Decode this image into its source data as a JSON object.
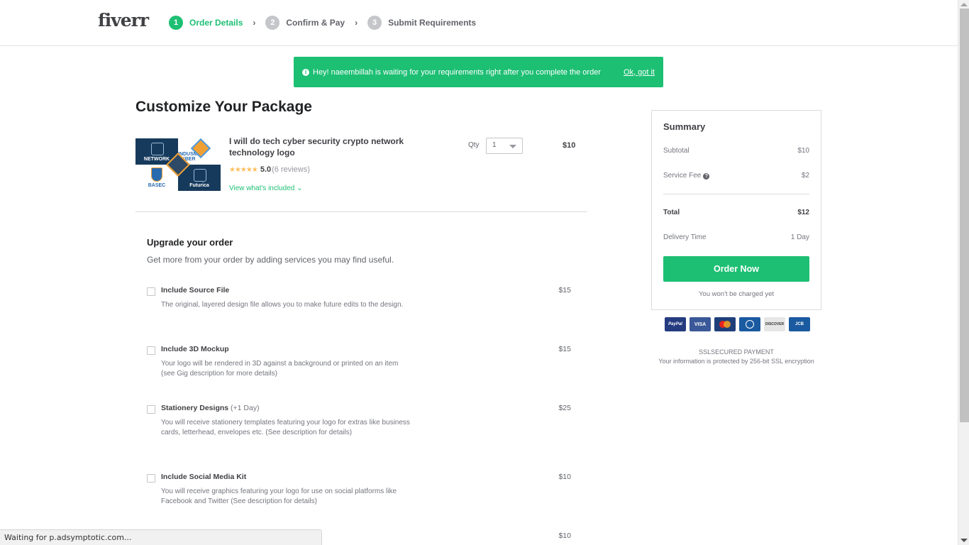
{
  "header": {
    "logo": "fiverr",
    "steps": [
      {
        "num": "1",
        "label": "Order Details",
        "active": true
      },
      {
        "num": "2",
        "label": "Confirm & Pay",
        "active": false
      },
      {
        "num": "3",
        "label": "Submit Requirements",
        "active": false
      }
    ],
    "separator": "›"
  },
  "banner": {
    "icon": "info-icon",
    "message": "Hey! naeembillah is waiting for your requirements right after you complete the order",
    "dismiss_label": "Ok, got it"
  },
  "page_title": "Customize Your Package",
  "gig": {
    "title": "I will do tech cyber security crypto network technology logo",
    "image_labels": [
      "NETWORK",
      "INDUSMIC CYBER",
      "BASEC",
      "Futurica"
    ],
    "stars": "★★★★★",
    "rating": "5.0",
    "reviews": "(6 reviews)",
    "view_included": "View what's included ⌄",
    "qty_label": "Qty",
    "qty_value": "1",
    "price": "$10"
  },
  "upgrade": {
    "title": "Upgrade your order",
    "subtitle": "Get more from your order by adding services you may find useful.",
    "extras": [
      {
        "name": "Include Source File",
        "note": "",
        "description": "The original, layered design file allows you to make future edits to the design.",
        "price": "$15",
        "checked": false
      },
      {
        "name": "Include 3D Mockup",
        "note": "",
        "description": "Your logo will be rendered in 3D against a background or printed on an item (see Gig description for more details)",
        "price": "$15",
        "checked": false
      },
      {
        "name": "Stationery Designs",
        "note": "(+1 Day)",
        "description": "You will receive stationery templates featuring your logo for extras like business cards, letterhead, envelopes etc. (See description for details)",
        "price": "$25",
        "checked": false
      },
      {
        "name": "Include Social Media Kit",
        "note": "",
        "description": "You will receive graphics featuring your logo for use on social platforms like Facebook and Twitter (See description for details)",
        "price": "$10",
        "checked": false
      },
      {
        "name": "",
        "note": "",
        "description": "",
        "price": "$10",
        "checked": false
      }
    ]
  },
  "summary": {
    "title": "Summary",
    "subtotal_label": "Subtotal",
    "subtotal_value": "$10",
    "fee_label": "Service Fee",
    "fee_value": "$2",
    "total_label": "Total",
    "total_value": "$12",
    "delivery_label": "Delivery Time",
    "delivery_value": "1 Day",
    "order_button": "Order Now",
    "not_charged": "You won't be charged yet"
  },
  "payments": {
    "methods": [
      "PayPal",
      "VISA",
      "MasterCard",
      "Diners",
      "DISCOVER",
      "JCB"
    ],
    "ssl_title": "SSLSECURED PAYMENT",
    "ssl_sub": "Your information is protected by 256-bit SSL encryption"
  },
  "statusbar": {
    "text": "Waiting for p.adsymptotic.com..."
  },
  "colors": {
    "brand_green": "#1dbf73",
    "text_dark": "#404145",
    "text_muted": "#74767e"
  }
}
